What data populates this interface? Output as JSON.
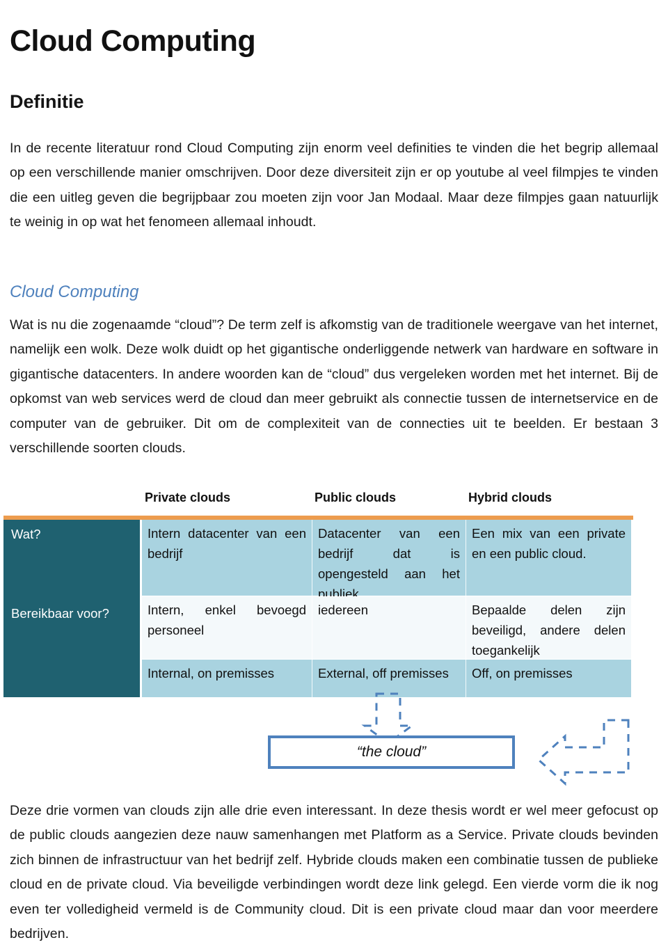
{
  "document": {
    "title": "Cloud Computing",
    "heading_definitie": "Definitie",
    "heading_cloud_computing": "Cloud Computing",
    "paragraph_1": "In de recente literatuur rond Cloud Computing zijn enorm veel definities te vinden die het begrip allemaal op een verschillende manier omschrijven. Door deze diversiteit zijn er op youtube al veel filmpjes te vinden die een uitleg geven die begrijpbaar zou moeten zijn voor Jan Modaal. Maar deze filmpjes gaan natuurlijk te weinig in op wat het fenomeen allemaal inhoudt.",
    "paragraph_2": "Wat is nu die zogenaamde “cloud”? De term zelf is afkomstig van de traditionele weergave van het internet, namelijk een wolk. Deze wolk duidt op het gigantische onderliggende netwerk van hardware en software in gigantische datacenters. In andere woorden kan de “cloud” dus vergeleken worden met het internet. Bij de opkomst van web services werd de cloud dan meer gebruikt als connectie tussen de internetservice en de computer van de gebruiker. Dit om de complexiteit van de connecties uit te beelden. Er bestaan 3 verschillende soorten clouds.",
    "paragraph_3": "Deze drie vormen van clouds zijn alle drie even interessant. In deze thesis wordt er wel meer gefocust op de public clouds aangezien deze nauw samenhangen met Platform as a Service. Private clouds bevinden zich binnen de infrastructuur van het bedrijf zelf. Hybride clouds maken een combinatie tussen de publieke cloud en de private cloud. Via beveiligde verbindingen wordt deze link gelegd. Een vierde vorm die ik nog even ter volledigheid vermeld is de Community cloud. Dit is een private cloud maar dan voor meerdere bedrijven."
  },
  "table": {
    "column_headers": [
      "Private clouds",
      "Public clouds",
      "Hybrid clouds"
    ],
    "row_labels": [
      "Wat?",
      "Bereikbaar voor?"
    ],
    "rows": [
      {
        "label": "Wat?",
        "cells": [
          "Intern datacenter van een bedrijf",
          "Datacenter van een bedrijf dat is opengesteld aan het publiek.",
          "Een mix van een private en een public cloud."
        ]
      },
      {
        "label": "Bereikbaar voor?",
        "cells": [
          "Intern, enkel bevoegd personeel",
          "iedereen",
          "Bepaalde delen zijn beveiligd, andere delen toegankelijk"
        ]
      },
      {
        "label": "",
        "cells": [
          "Internal, on premisses",
          "External, off premisses",
          "Off, on premisses"
        ]
      }
    ]
  },
  "diagram": {
    "cloud_box_label": "“the cloud”",
    "arrow_down_name": "dashed-down-arrow",
    "arrow_left_name": "dashed-left-arrow"
  },
  "colors": {
    "accent_blue": "#4E81BD",
    "table_header_teal": "#1F6170",
    "table_cell_blue": "#A9D3E0",
    "table_cell_light": "#F4F9FB",
    "orange_rule": "#ED9C4E"
  }
}
